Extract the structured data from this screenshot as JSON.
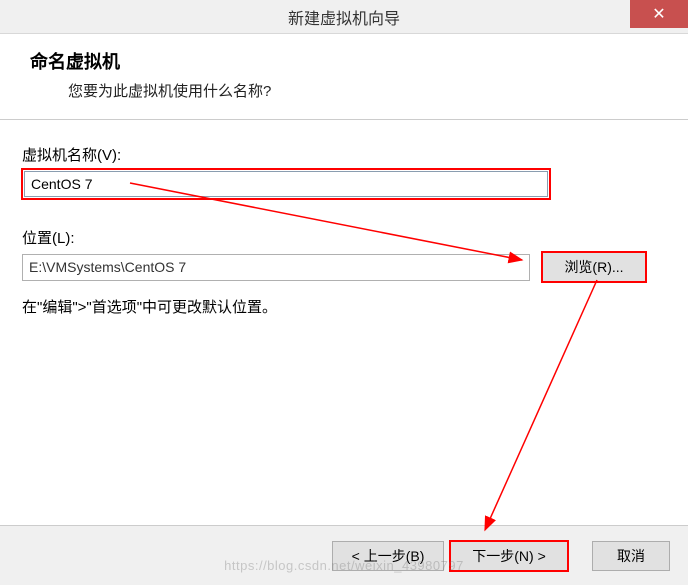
{
  "titlebar": {
    "title": "新建虚拟机向导",
    "close": "✕"
  },
  "header": {
    "title": "命名虚拟机",
    "subtitle": "您要为此虚拟机使用什么名称?"
  },
  "fields": {
    "name_label": "虚拟机名称(V):",
    "name_value": "CentOS 7",
    "location_label": "位置(L):",
    "location_value": "E:\\VMSystems\\CentOS 7",
    "browse_label": "浏览(R)..."
  },
  "hint": "在\"编辑\">\"首选项\"中可更改默认位置。",
  "footer": {
    "back": "< 上一步(B)",
    "next": "下一步(N) >",
    "cancel": "取消"
  },
  "watermark": "https://blog.csdn.net/weixin_43980797"
}
